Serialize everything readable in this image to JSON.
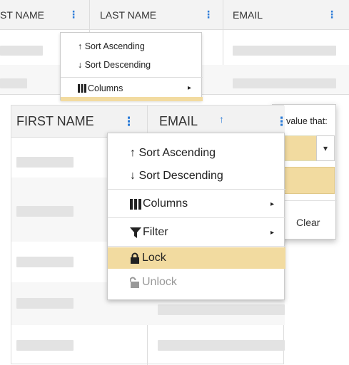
{
  "bg_grid": {
    "columns": [
      {
        "label": "ST NAME",
        "menu_glyph": "⋮"
      },
      {
        "label": "LAST NAME",
        "menu_glyph": "⋮"
      },
      {
        "label": "EMAIL",
        "menu_glyph": "⋮"
      }
    ],
    "menu": {
      "sort_asc": "↑ Sort Ascending",
      "sort_desc": "↓ Sort Descending",
      "columns": "Columns",
      "submenu_arrow": "▸"
    }
  },
  "filter_panel": {
    "prompt": "value that:",
    "dropdown_arrow": "▾",
    "clear_label": "Clear"
  },
  "front_grid": {
    "columns": [
      {
        "label": "FIRST NAME",
        "menu_glyph": "⋮"
      },
      {
        "label": "EMAIL",
        "sort_indicator": "↑",
        "menu_glyph": "⋮"
      }
    ],
    "menu": {
      "sort_asc": "↑ Sort Ascending",
      "sort_desc": "↓ Sort Descending",
      "columns": "Columns",
      "filter": "Filter",
      "lock": "Lock",
      "unlock": "Unlock",
      "submenu_arrow": "▸"
    }
  },
  "colors": {
    "accent": "#2b7bd8",
    "highlight": "#f2dba0",
    "placeholder": "#e3e3e3"
  }
}
